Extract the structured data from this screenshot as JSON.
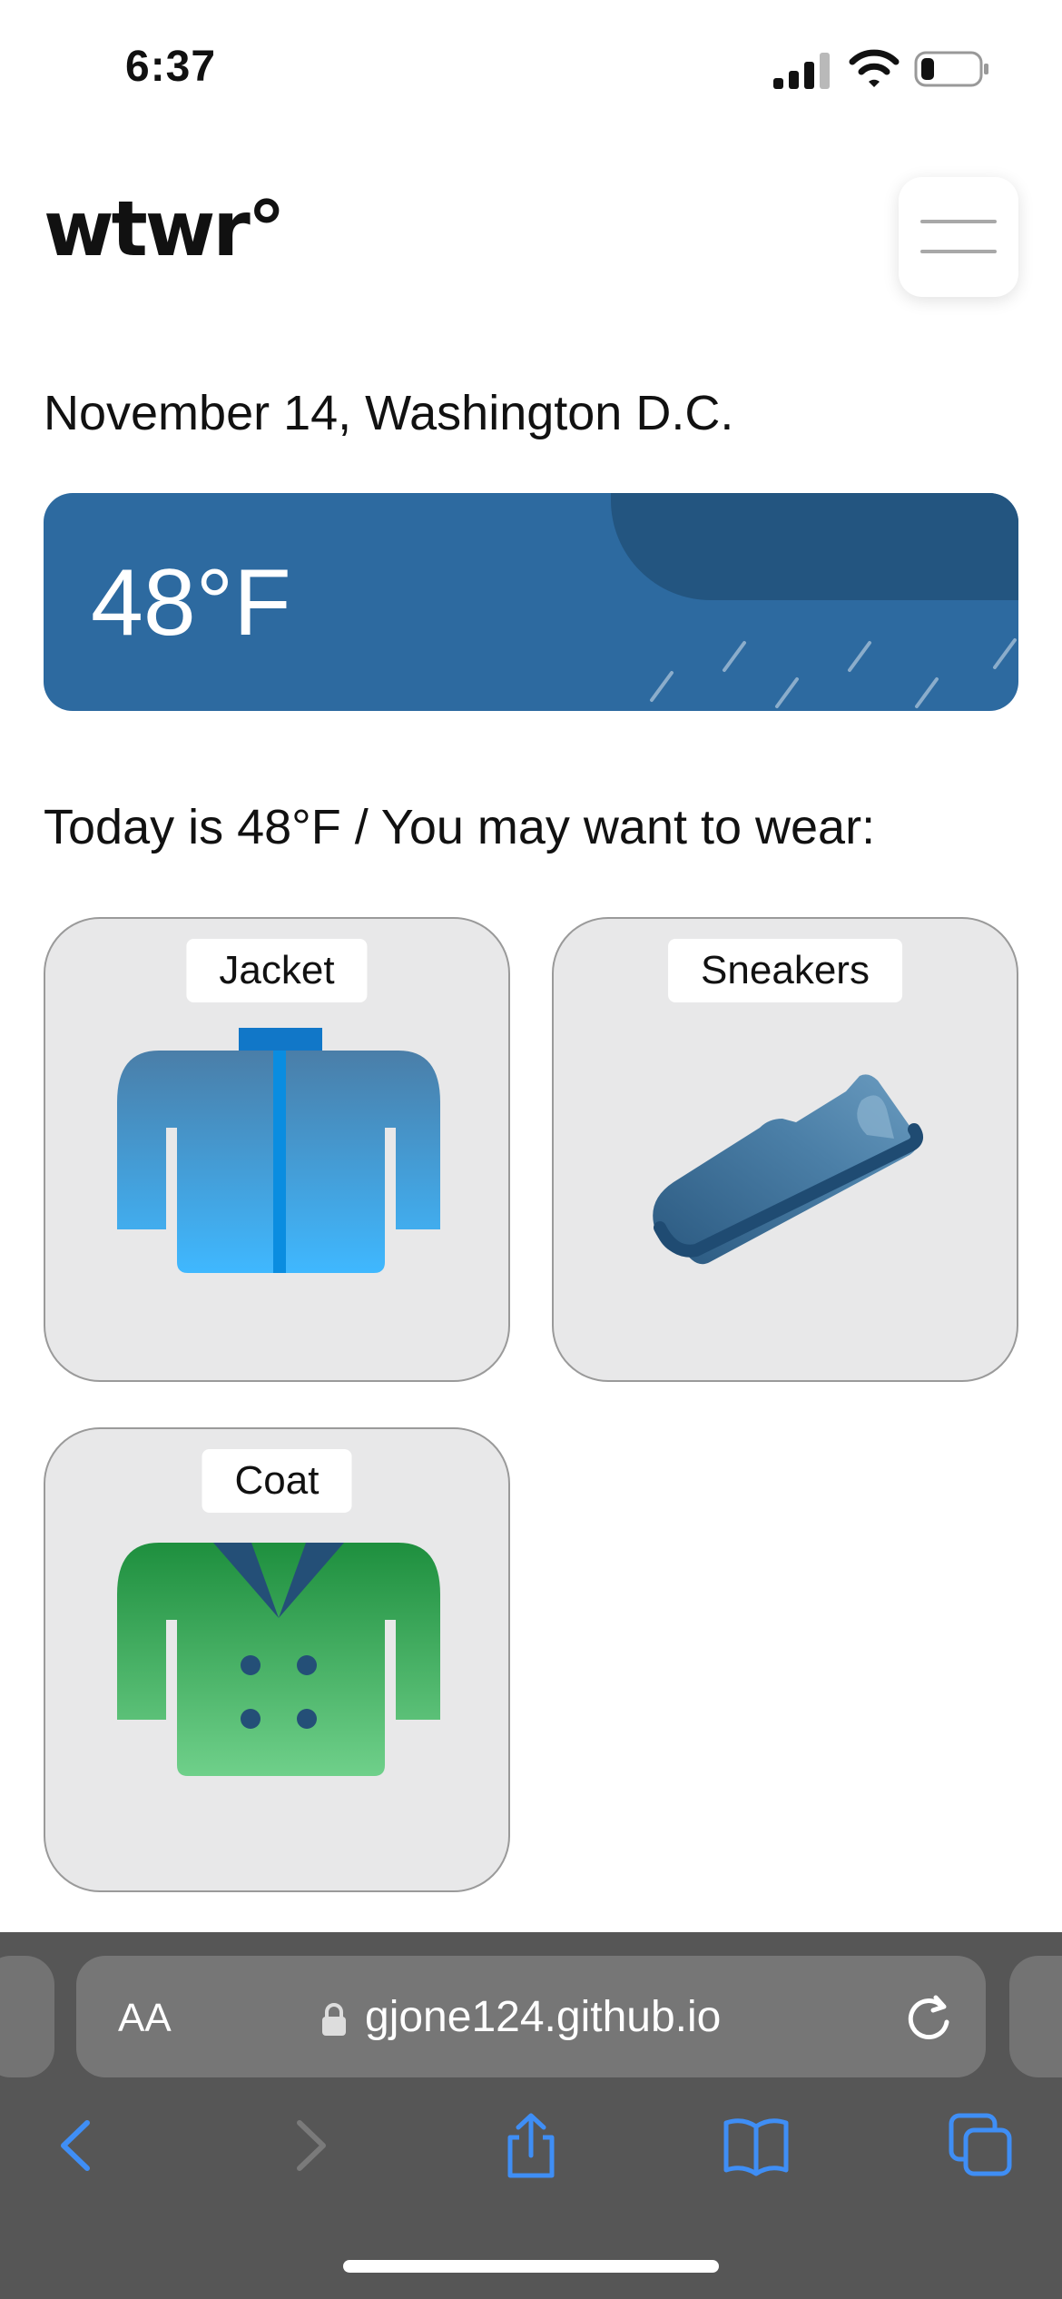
{
  "status_bar": {
    "time": "6:37"
  },
  "header": {
    "logo": "wtwr°"
  },
  "date_location": "November 14, Washington D.C.",
  "weather": {
    "temperature": "48°F",
    "condition_icon": "rain-cloud"
  },
  "recommendation": "Today is 48°F / You may want to wear:",
  "items": [
    {
      "name": "Jacket",
      "icon": "jacket-icon",
      "color": "#3fb6ff"
    },
    {
      "name": "Sneakers",
      "icon": "sneaker-icon",
      "color": "#3a6e98"
    },
    {
      "name": "Coat",
      "icon": "coat-icon",
      "color": "#1f9a44"
    }
  ],
  "browser": {
    "aa_label": "AA",
    "url": "gjone124.github.io",
    "accent_color": "#3f8ef5"
  }
}
